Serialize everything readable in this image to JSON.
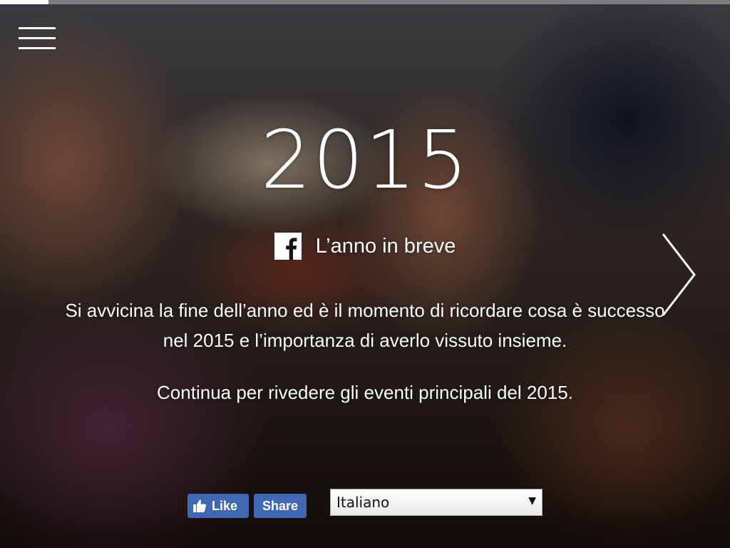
{
  "progress": {
    "fraction": 0.066
  },
  "menu": {
    "icon": "hamburger-menu-icon"
  },
  "hero": {
    "year": "2015",
    "brand_icon": "facebook-logo-icon",
    "brand_title": "L’anno in breve",
    "intro_line1": "Si avvicina la fine dell’anno ed è il momento di ricordare cosa è successo",
    "intro_line2": "nel 2015 e l’importanza di averlo vissuto insieme.",
    "continue_text": "Continua per rivedere gli eventi principali del 2015."
  },
  "navigation": {
    "next_icon": "chevron-right-icon"
  },
  "social": {
    "like_label": "Like",
    "like_icon": "thumbs-up-icon",
    "share_label": "Share",
    "button_color": "#4267b2"
  },
  "language": {
    "selected": "Italiano",
    "arrow": "▼"
  }
}
